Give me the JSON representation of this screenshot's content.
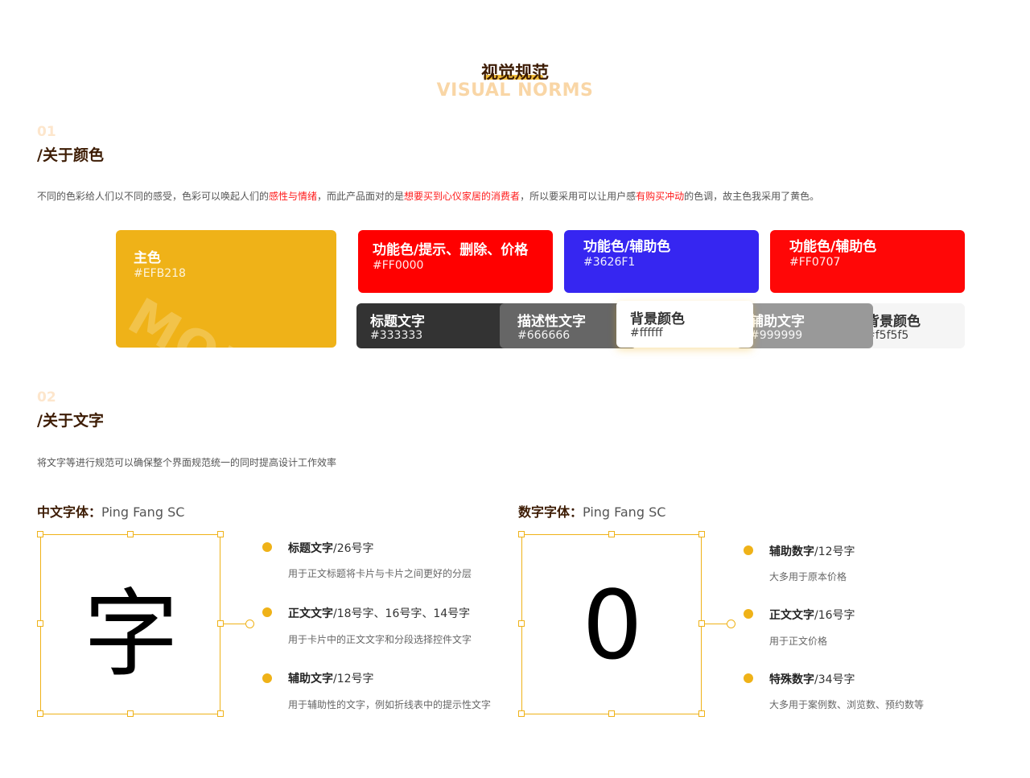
{
  "header": {
    "title_cn": "视觉规范",
    "title_en": "VISUAL NORMS"
  },
  "colors_section": {
    "number": "01",
    "title": "/关于颜色",
    "desc_parts": [
      "不同的色彩给人们以不同的感受，色彩可以唤起人们的",
      "感性与情绪",
      "，而此产品面对的是",
      "想要买到心仪家居的消费者",
      "，所以要采用可以让用户感",
      "有购买冲动",
      "的色调，故主色我采用了黄色。"
    ],
    "main_card": {
      "title": "主色",
      "hex": "#EFB218",
      "watermark": "MOMO",
      "color": "#EFB218"
    },
    "function_cards": [
      {
        "title": "功能色/提示、删除、价格",
        "hex": "#FF0000",
        "color": "#FF0000"
      },
      {
        "title": "功能色/辅助色",
        "hex": "#3626F1",
        "color": "#3626F1"
      },
      {
        "title": "功能色/辅助色",
        "hex": "#FF0707",
        "color": "#FF0707"
      }
    ],
    "neutral_cards": [
      {
        "title": "标题文字",
        "hex": "#333333",
        "color": "#333333"
      },
      {
        "title": "描述性文字",
        "hex": "#666666",
        "color": "#666666"
      },
      {
        "title": "背景颜色",
        "hex": "#ffffff",
        "color": "#ffffff"
      },
      {
        "title": "辅助文字",
        "hex": "#999999",
        "color": "#999999"
      },
      {
        "title": "背景颜色",
        "hex": "#f5f5f5",
        "color": "#f5f5f5"
      }
    ]
  },
  "text_section": {
    "number": "02",
    "title": "/关于文字",
    "desc": "将文字等进行规范可以确保整个界面规范统一的同时提高设计工作效率",
    "chinese_font": {
      "label": "中文字体：",
      "name": "Ping Fang SC",
      "sample": "字",
      "items": [
        {
          "name": "标题文字",
          "spec": "/26号字",
          "desc": "用于正文标题将卡片与卡片之间更好的分层"
        },
        {
          "name": "正文文字",
          "spec": "/18号字、16号字、14号字",
          "desc": "用于卡片中的正文文字和分段选择控件文字"
        },
        {
          "name": "辅助文字",
          "spec": "/12号字",
          "desc": "用于辅助性的文字，例如折线表中的提示性文字"
        }
      ]
    },
    "number_font": {
      "label": "数字字体：",
      "name": "Ping Fang SC",
      "sample": "0",
      "items": [
        {
          "name": "辅助数字",
          "spec": "/12号字",
          "desc": "大多用于原本价格"
        },
        {
          "name": "正文文字",
          "spec": "/16号字",
          "desc": "用于正文价格"
        },
        {
          "name": "特殊数字",
          "spec": "/34号字",
          "desc": "大多用于案例数、浏览数、预约数等"
        }
      ]
    }
  }
}
